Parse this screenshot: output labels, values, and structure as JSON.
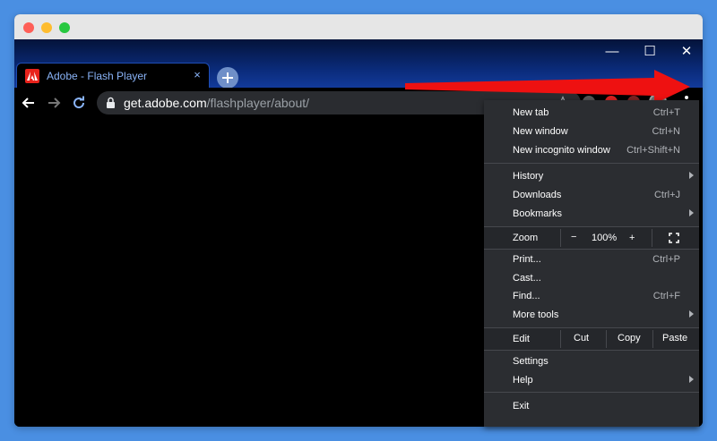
{
  "tab": {
    "title": "Adobe - Flash Player",
    "close": "×"
  },
  "window_controls": {
    "minimize": "—",
    "maximize": "☐",
    "close": "✕"
  },
  "url": {
    "host": "get.adobe.com",
    "path": "/flashplayer/about/"
  },
  "menu": {
    "new_tab": {
      "label": "New tab",
      "shortcut": "Ctrl+T"
    },
    "new_window": {
      "label": "New window",
      "shortcut": "Ctrl+N"
    },
    "incognito": {
      "label": "New incognito window",
      "shortcut": "Ctrl+Shift+N"
    },
    "history": {
      "label": "History"
    },
    "downloads": {
      "label": "Downloads",
      "shortcut": "Ctrl+J"
    },
    "bookmarks": {
      "label": "Bookmarks"
    },
    "zoom": {
      "label": "Zoom",
      "minus": "−",
      "level": "100%",
      "plus": "+"
    },
    "print": {
      "label": "Print...",
      "shortcut": "Ctrl+P"
    },
    "cast": {
      "label": "Cast..."
    },
    "find": {
      "label": "Find...",
      "shortcut": "Ctrl+F"
    },
    "more_tools": {
      "label": "More tools"
    },
    "edit": {
      "label": "Edit",
      "cut": "Cut",
      "copy": "Copy",
      "paste": "Paste"
    },
    "settings": {
      "label": "Settings"
    },
    "help": {
      "label": "Help"
    },
    "exit": {
      "label": "Exit"
    }
  },
  "colors": {
    "background": "#4a8fe2",
    "tabstrip": "#0a2a78",
    "menu": "#2b2d31",
    "arrow": "#ee1111",
    "tab_text": "#8ab4f8"
  },
  "icons": [
    "adobe-favicon",
    "new-tab-plus-icon",
    "back-arrow-icon",
    "forward-arrow-icon",
    "reload-icon",
    "lock-icon",
    "bookmark-star-icon",
    "extension-icon",
    "profile-avatar",
    "kebab-menu-icon",
    "fullscreen-icon",
    "red-arrow-annotation"
  ]
}
